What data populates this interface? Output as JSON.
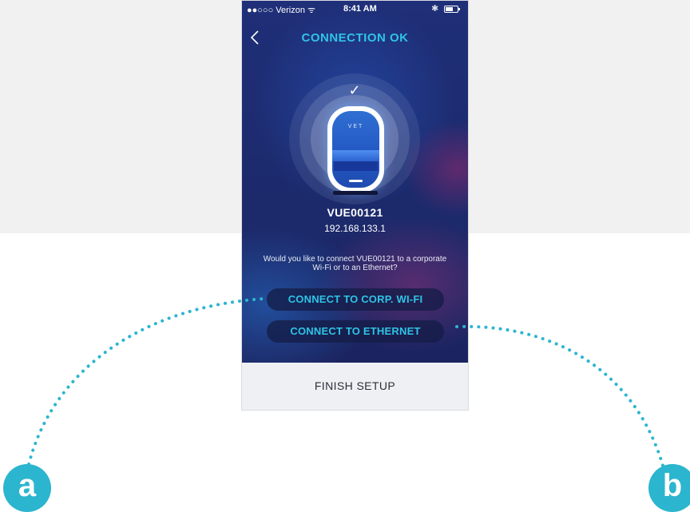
{
  "status_bar": {
    "carrier": "●●○○○ Verizon ᯤ",
    "time": "8:41 AM",
    "bluetooth_icon": "bluetooth-icon",
    "battery_icon": "battery-icon"
  },
  "header": {
    "back_icon": "chevron-left-icon",
    "title": "CONNECTION OK"
  },
  "device": {
    "logo": "VET",
    "name": "VUE00121",
    "ip": "192.168.133.1",
    "check_icon": "checkmark-icon"
  },
  "prompt": "Would you like to connect VUE00121 to a corporate Wi-Fi or to an Ethernet?",
  "buttons": {
    "wifi": "CONNECT TO CORP. WI-FI",
    "ethernet": "CONNECT TO ETHERNET",
    "finish": "FINISH SETUP"
  },
  "callouts": {
    "a": "a",
    "b": "b"
  },
  "colors": {
    "accent": "#2fc4e6",
    "callout": "#2cb5cf",
    "screen_bg": "#1f2f78",
    "page_bg": "#f1f1f2"
  }
}
